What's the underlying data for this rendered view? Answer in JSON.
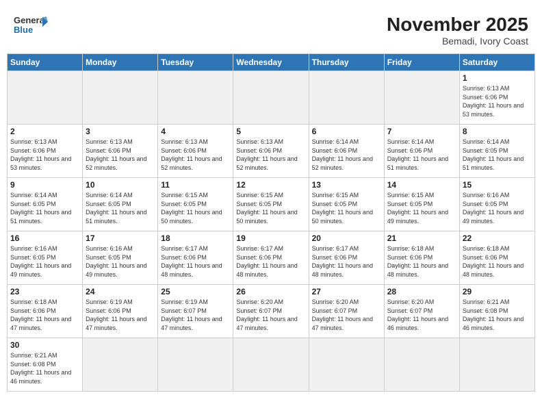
{
  "header": {
    "logo_general": "General",
    "logo_blue": "Blue",
    "month_year": "November 2025",
    "location": "Bemadi, Ivory Coast"
  },
  "weekdays": [
    "Sunday",
    "Monday",
    "Tuesday",
    "Wednesday",
    "Thursday",
    "Friday",
    "Saturday"
  ],
  "days": [
    {
      "num": "",
      "empty": true
    },
    {
      "num": "",
      "empty": true
    },
    {
      "num": "",
      "empty": true
    },
    {
      "num": "",
      "empty": true
    },
    {
      "num": "",
      "empty": true
    },
    {
      "num": "",
      "empty": true
    },
    {
      "num": "1",
      "sunrise": "6:13 AM",
      "sunset": "6:06 PM",
      "daylight": "11 hours and 53 minutes."
    },
    {
      "num": "2",
      "sunrise": "6:13 AM",
      "sunset": "6:06 PM",
      "daylight": "11 hours and 53 minutes."
    },
    {
      "num": "3",
      "sunrise": "6:13 AM",
      "sunset": "6:06 PM",
      "daylight": "11 hours and 52 minutes."
    },
    {
      "num": "4",
      "sunrise": "6:13 AM",
      "sunset": "6:06 PM",
      "daylight": "11 hours and 52 minutes."
    },
    {
      "num": "5",
      "sunrise": "6:13 AM",
      "sunset": "6:06 PM",
      "daylight": "11 hours and 52 minutes."
    },
    {
      "num": "6",
      "sunrise": "6:14 AM",
      "sunset": "6:06 PM",
      "daylight": "11 hours and 52 minutes."
    },
    {
      "num": "7",
      "sunrise": "6:14 AM",
      "sunset": "6:06 PM",
      "daylight": "11 hours and 51 minutes."
    },
    {
      "num": "8",
      "sunrise": "6:14 AM",
      "sunset": "6:05 PM",
      "daylight": "11 hours and 51 minutes."
    },
    {
      "num": "9",
      "sunrise": "6:14 AM",
      "sunset": "6:05 PM",
      "daylight": "11 hours and 51 minutes."
    },
    {
      "num": "10",
      "sunrise": "6:14 AM",
      "sunset": "6:05 PM",
      "daylight": "11 hours and 51 minutes."
    },
    {
      "num": "11",
      "sunrise": "6:15 AM",
      "sunset": "6:05 PM",
      "daylight": "11 hours and 50 minutes."
    },
    {
      "num": "12",
      "sunrise": "6:15 AM",
      "sunset": "6:05 PM",
      "daylight": "11 hours and 50 minutes."
    },
    {
      "num": "13",
      "sunrise": "6:15 AM",
      "sunset": "6:05 PM",
      "daylight": "11 hours and 50 minutes."
    },
    {
      "num": "14",
      "sunrise": "6:15 AM",
      "sunset": "6:05 PM",
      "daylight": "11 hours and 49 minutes."
    },
    {
      "num": "15",
      "sunrise": "6:16 AM",
      "sunset": "6:05 PM",
      "daylight": "11 hours and 49 minutes."
    },
    {
      "num": "16",
      "sunrise": "6:16 AM",
      "sunset": "6:05 PM",
      "daylight": "11 hours and 49 minutes."
    },
    {
      "num": "17",
      "sunrise": "6:16 AM",
      "sunset": "6:05 PM",
      "daylight": "11 hours and 49 minutes."
    },
    {
      "num": "18",
      "sunrise": "6:17 AM",
      "sunset": "6:06 PM",
      "daylight": "11 hours and 48 minutes."
    },
    {
      "num": "19",
      "sunrise": "6:17 AM",
      "sunset": "6:06 PM",
      "daylight": "11 hours and 48 minutes."
    },
    {
      "num": "20",
      "sunrise": "6:17 AM",
      "sunset": "6:06 PM",
      "daylight": "11 hours and 48 minutes."
    },
    {
      "num": "21",
      "sunrise": "6:18 AM",
      "sunset": "6:06 PM",
      "daylight": "11 hours and 48 minutes."
    },
    {
      "num": "22",
      "sunrise": "6:18 AM",
      "sunset": "6:06 PM",
      "daylight": "11 hours and 48 minutes."
    },
    {
      "num": "23",
      "sunrise": "6:18 AM",
      "sunset": "6:06 PM",
      "daylight": "11 hours and 47 minutes."
    },
    {
      "num": "24",
      "sunrise": "6:19 AM",
      "sunset": "6:06 PM",
      "daylight": "11 hours and 47 minutes."
    },
    {
      "num": "25",
      "sunrise": "6:19 AM",
      "sunset": "6:07 PM",
      "daylight": "11 hours and 47 minutes."
    },
    {
      "num": "26",
      "sunrise": "6:20 AM",
      "sunset": "6:07 PM",
      "daylight": "11 hours and 47 minutes."
    },
    {
      "num": "27",
      "sunrise": "6:20 AM",
      "sunset": "6:07 PM",
      "daylight": "11 hours and 47 minutes."
    },
    {
      "num": "28",
      "sunrise": "6:20 AM",
      "sunset": "6:07 PM",
      "daylight": "11 hours and 46 minutes."
    },
    {
      "num": "29",
      "sunrise": "6:21 AM",
      "sunset": "6:08 PM",
      "daylight": "11 hours and 46 minutes."
    },
    {
      "num": "30",
      "sunrise": "6:21 AM",
      "sunset": "6:08 PM",
      "daylight": "11 hours and 46 minutes."
    },
    {
      "num": "",
      "empty": true
    },
    {
      "num": "",
      "empty": true
    },
    {
      "num": "",
      "empty": true
    },
    {
      "num": "",
      "empty": true
    },
    {
      "num": "",
      "empty": true
    },
    {
      "num": "",
      "empty": true
    }
  ]
}
